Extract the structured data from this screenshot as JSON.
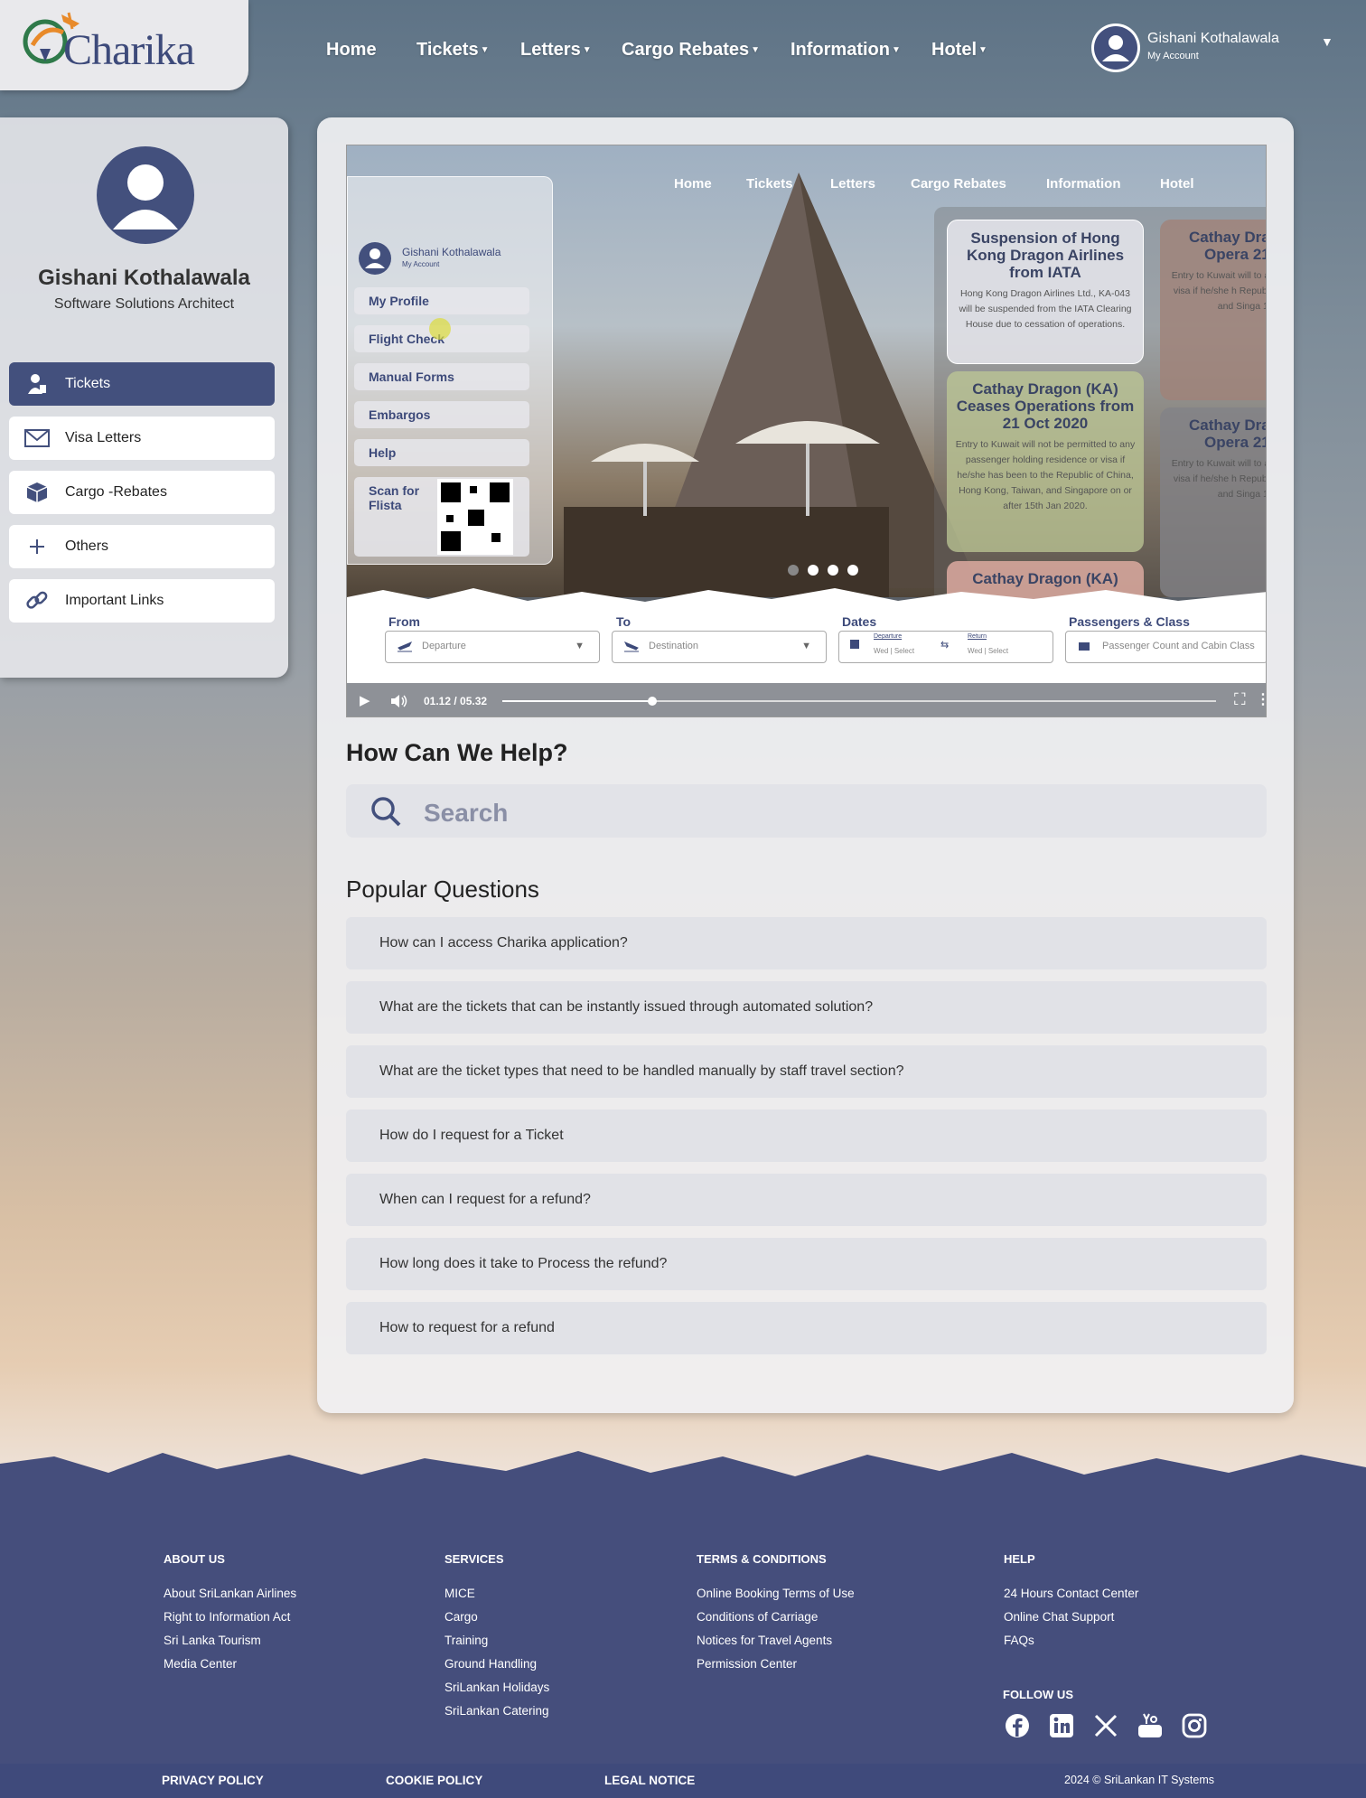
{
  "header": {
    "logo_text": "Charika",
    "nav": [
      {
        "label": "Home",
        "dropdown": false
      },
      {
        "label": "Tickets",
        "dropdown": true
      },
      {
        "label": "Letters",
        "dropdown": true
      },
      {
        "label": "Cargo Rebates",
        "dropdown": true
      },
      {
        "label": "Information",
        "dropdown": true
      },
      {
        "label": "Hotel",
        "dropdown": true
      }
    ],
    "account": {
      "name": "Gishani Kothalawala",
      "sub": "My Account",
      "caret": "▼"
    }
  },
  "sidebar": {
    "name": "Gishani Kothalawala",
    "role": "Software Solutions Architect",
    "items": [
      {
        "label": "Tickets",
        "icon": "user-ticket-icon",
        "active": true
      },
      {
        "label": "Visa Letters",
        "icon": "envelope-icon",
        "active": false
      },
      {
        "label": "Cargo -Rebates",
        "icon": "box-icon",
        "active": false
      },
      {
        "label": "Others",
        "icon": "plus-icon",
        "active": false
      },
      {
        "label": "Important Links",
        "icon": "link-icon",
        "active": false
      }
    ]
  },
  "video": {
    "nav": [
      "Home",
      "Tickets",
      "Letters",
      "Cargo Rebates",
      "Information",
      "Hotel"
    ],
    "menu_account": {
      "name": "Gishani Kothalawala",
      "sub": "My Account"
    },
    "menu_items": [
      "My Profile",
      "Flight Check",
      "Manual Forms",
      "Embargos",
      "Help"
    ],
    "scan_label": "Scan for Flista",
    "news": [
      {
        "title": "Suspension of Hong Kong Dragon Airlines from IATA",
        "body": "Hong Kong Dragon Airlines Ltd., KA-043 will be suspended from the IATA Clearing House due to cessation of operations."
      },
      {
        "title": "Cathay Dragon (KA) Ceases Operations from 21 Oct 2020",
        "body": "Entry to Kuwait will not be permitted to any passenger holding residence or visa if he/she has been to the Republic of China, Hong Kong, Taiwan, and Singapore on or after 15th Jan 2020."
      },
      {
        "title": "Cathay Dragon (KA)",
        "body": ""
      },
      {
        "title": "Cathay Dra Ceases Opera 21 Oct 2",
        "body": "Entry to Kuwait will to any passenger h or visa if he/she h Republic of Chin Taiwan, and Singa 15th Jan"
      },
      {
        "title": "Cathay Dra Ceases Opera 21 Oct 2",
        "body": "Entry to Kuwait will to any passenger h or visa if he/she h Republic of Chin Taiwan, and Singa 15th Jan"
      }
    ],
    "booking": {
      "from_label": "From",
      "from_ph": "Departure",
      "to_label": "To",
      "to_ph": "Destination",
      "dates_label": "Dates",
      "departure": "Departure",
      "return": "Return",
      "wed": "Wed",
      "select": "Select",
      "pax_label": "Passengers & Class",
      "pax_ph": "Passenger Count and Cabin Class"
    },
    "time": "01.12 / 05.32",
    "progress": 0.21
  },
  "help": {
    "title": "How Can We Help?",
    "search_placeholder": "Search",
    "popular_title": "Popular Questions",
    "questions": [
      "How can I access Charika application?",
      "What are the tickets that can be instantly issued through automated solution?",
      "What are the ticket types that need to be handled manually by staff travel section?",
      "How do I request for a Ticket",
      "When can I request for a refund?",
      "How long does it take to Process the refund?",
      "How to request for a refund"
    ]
  },
  "footer": {
    "about": {
      "title": "ABOUT US",
      "links": [
        "About SriLankan Airlines",
        "Right to Information Act",
        "Sri Lanka Tourism",
        "Media Center"
      ]
    },
    "services": {
      "title": "SERVICES",
      "links": [
        "MICE",
        "Cargo",
        "Training",
        "Ground Handling",
        "SriLankan Holidays",
        "SriLankan Catering"
      ]
    },
    "terms": {
      "title": "TERMS & CONDITIONS",
      "links": [
        "Online Booking Terms of Use",
        "Conditions of Carriage",
        "Notices for Travel Agents",
        "Permission Center"
      ]
    },
    "help": {
      "title": "HELP",
      "links": [
        "24 Hours Contact Center",
        "Online Chat Support",
        "FAQs"
      ]
    },
    "follow_title": "FOLLOW US",
    "social": [
      "facebook-icon",
      "linkedin-icon",
      "x-icon",
      "youtube-icon",
      "instagram-icon"
    ],
    "bottom": {
      "privacy": "PRIVACY POLICY",
      "cookie": "COOKIE POLICY",
      "legal": "LEGAL NOTICE",
      "copyright": "2024 © SriLankan IT Systems"
    }
  },
  "colors": {
    "brand": "#43507d",
    "footer": "#454e7c",
    "accent_orange": "#e88a2a"
  }
}
